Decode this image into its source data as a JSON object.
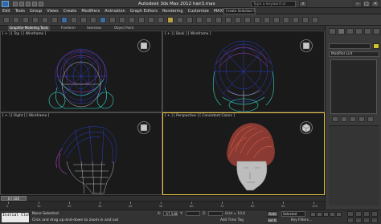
{
  "titlebar": {
    "title": "Autodesk 3ds Max 2012     hair3.max",
    "search_placeholder": "Type a keyword or phrase"
  },
  "menubar": {
    "items": [
      "Edit",
      "Tools",
      "Group",
      "Views",
      "Create",
      "Modifiers",
      "Animation",
      "Graph Editors",
      "Rendering",
      "Customize",
      "MAXScript",
      "Help"
    ],
    "workspace": "Create Selection Set"
  },
  "ribbon": {
    "tabs": [
      "Graphite Modeling Tools",
      "Freeform",
      "Selection",
      "Object Paint"
    ],
    "active_tab": 0
  },
  "viewports": {
    "top": {
      "label": "[ + ] [ Top ] [ Wireframe ]"
    },
    "back": {
      "label": "[ + ] [ Back ] [ Wireframe ]"
    },
    "right": {
      "label": "[ + ] [ Right ] [ Wireframe ]"
    },
    "perspective": {
      "label": "[ + ] [ Perspective ] [ Consistent Colors ]"
    }
  },
  "command_panel": {
    "modifier_list": "Modifier List",
    "object_color": "#d2c62b"
  },
  "timeline": {
    "handle": "0 / 100",
    "ticks": [
      "0",
      "10",
      "20",
      "30",
      "40",
      "50",
      "60",
      "70",
      "80",
      "90",
      "100"
    ]
  },
  "status": {
    "maxscript": "Initial Clut",
    "selection": "None Selected",
    "prompt": "Click and drag up-and-down to zoom in and out",
    "x_label": "X:",
    "x_value": "-57.548",
    "y_label": "Y:",
    "y_value": "",
    "z_label": "Z:",
    "z_value": "",
    "grid": "Grid = 10.0",
    "add_time_tag": "Add Time Tag",
    "auto_key": "Auto",
    "set_key": "Set K.",
    "selected": "Selected",
    "key_filters": "Key Filters..."
  },
  "colors": {
    "active_viewport": "#e8c440",
    "hair_blue": "#3a4ad8",
    "hair_purple": "#b040c8",
    "hair_cyan": "#30e0c8",
    "hair_red": "#c84040"
  }
}
